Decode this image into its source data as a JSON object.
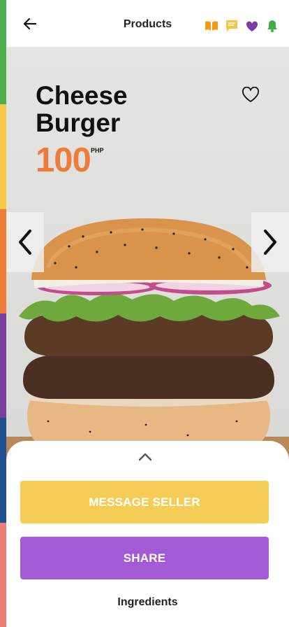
{
  "header": {
    "title": "Products",
    "icons": [
      "book-icon",
      "chat-icon",
      "heart-icon",
      "bell-icon"
    ]
  },
  "product": {
    "name_line1": "Cheese",
    "name_line2": "Burger",
    "price": "100",
    "currency": "PHP"
  },
  "actions": {
    "message_label": "MESSAGE SELLER",
    "share_label": "SHARE",
    "ingredients_label": "Ingredients"
  },
  "colors": {
    "strip": [
      "#4caf50",
      "#f7c948",
      "#ef7d3a",
      "#7b3fa0",
      "#1e4f8f",
      "#f07a7a"
    ],
    "price": "#ee7b39",
    "message_button": "#f5cc55",
    "share_button": "#a25bd5",
    "book_icon": "#f39c12",
    "chat_icon": "#f5c542",
    "heart_icon": "#7b3fa0",
    "bell_icon": "#3fae49"
  }
}
